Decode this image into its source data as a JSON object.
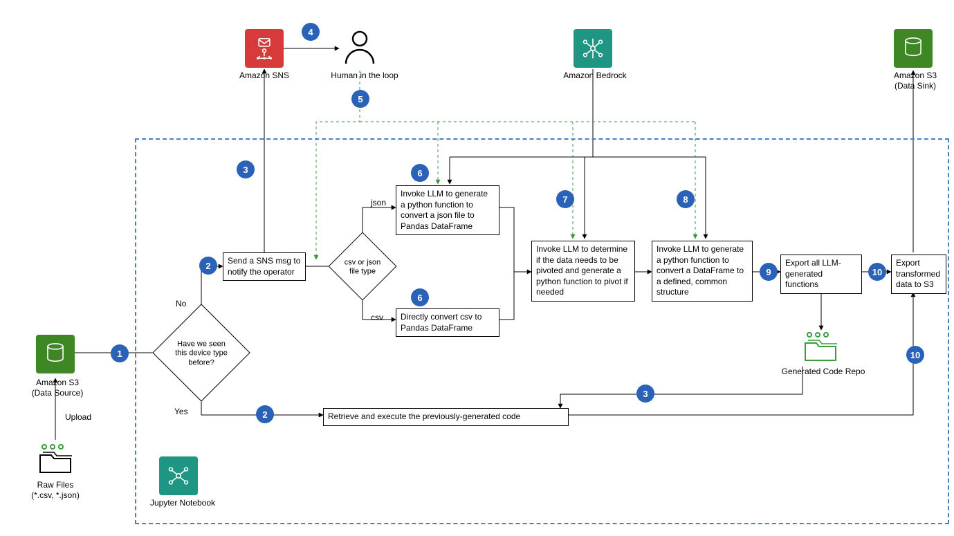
{
  "services": {
    "s3_source": "Amazon S3\n(Data Source)",
    "s3_sink": "Amazon S3\n(Data Sink)",
    "sns": "Amazon SNS",
    "bedrock": "Amazon Bedrock",
    "jupyter": "Jupyter Notebook",
    "raw_files": "Raw Files\n(*.csv, *.json)",
    "human": "Human in the loop",
    "code_repo": "Generated Code Repo"
  },
  "decisions": {
    "seen_before": "Have we seen\nthis device type\nbefore?",
    "file_type": "csv or\njson\nfile\ntype"
  },
  "steps": {
    "sns_msg": "Send a SNS msg to notify the operator",
    "json_llm": "Invoke LLM to generate a python function to convert a json file to Pandas DataFrame",
    "csv_direct": "Directly convert csv to Pandas DataFrame",
    "pivot": "Invoke LLM to determine if the data needs to be pivoted and generate a python function to pivot if needed",
    "structure": "Invoke LLM to generate a python function to convert a DataFrame to a defined, common structure",
    "export_fn": "Export all LLM-generated functions",
    "export_s3": "Export transformed data to S3",
    "retrieve": "Retrieve and execute the previously-generated code"
  },
  "edge_labels": {
    "upload": "Upload",
    "no": "No",
    "yes": "Yes",
    "json": "json",
    "csv": "csv"
  },
  "badges": {
    "b1": "1",
    "b2a": "2",
    "b2b": "2",
    "b3a": "3",
    "b3b": "3",
    "b4": "4",
    "b5": "5",
    "b6a": "6",
    "b6b": "6",
    "b7": "7",
    "b8": "8",
    "b9": "9",
    "b10a": "10",
    "b10b": "10"
  }
}
